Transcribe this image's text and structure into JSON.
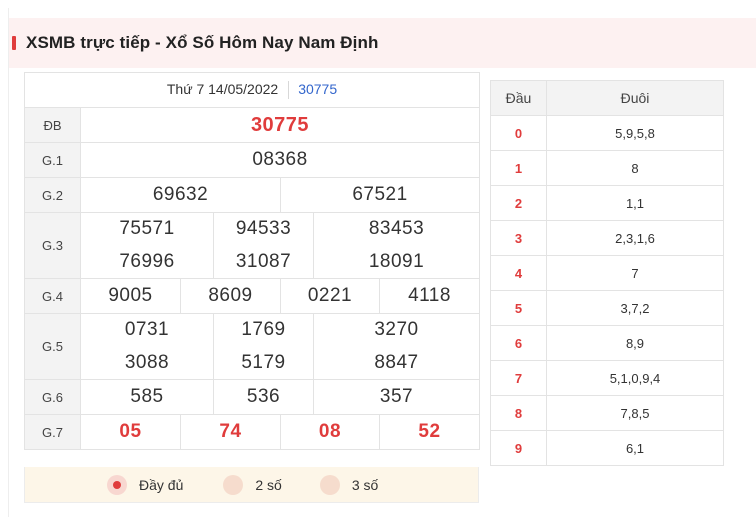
{
  "header": {
    "title": "XSMB trực tiếp - Xổ Số Hôm Nay Nam Định"
  },
  "results": {
    "date": "Thứ 7 14/05/2022",
    "code": "30775",
    "db": {
      "label": "ĐB",
      "value": "30775"
    },
    "g1": {
      "label": "G.1",
      "values": [
        "08368"
      ]
    },
    "g2": {
      "label": "G.2",
      "values": [
        "69632",
        "67521"
      ]
    },
    "g3": {
      "label": "G.3",
      "values": [
        "75571",
        "94533",
        "83453",
        "76996",
        "31087",
        "18091"
      ]
    },
    "g4": {
      "label": "G.4",
      "values": [
        "9005",
        "8609",
        "0221",
        "4118"
      ]
    },
    "g5": {
      "label": "G.5",
      "values": [
        "0731",
        "1769",
        "3270",
        "3088",
        "5179",
        "8847"
      ]
    },
    "g6": {
      "label": "G.6",
      "values": [
        "585",
        "536",
        "357"
      ]
    },
    "g7": {
      "label": "G.7",
      "values": [
        "05",
        "74",
        "08",
        "52"
      ]
    }
  },
  "options": [
    {
      "label": "Đầy đủ",
      "selected": true
    },
    {
      "label": "2 số",
      "selected": false
    },
    {
      "label": "3 số",
      "selected": false
    }
  ],
  "loto": {
    "head_label": "Đầu",
    "tail_label": "Đuôi",
    "rows": [
      {
        "head": "0",
        "tail": "5,9,5,8"
      },
      {
        "head": "1",
        "tail": "8"
      },
      {
        "head": "2",
        "tail": "1,1"
      },
      {
        "head": "3",
        "tail": "2,3,1,6"
      },
      {
        "head": "4",
        "tail": "7"
      },
      {
        "head": "5",
        "tail": "3,7,2"
      },
      {
        "head": "6",
        "tail": "8,9"
      },
      {
        "head": "7",
        "tail": "5,1,0,9,4"
      },
      {
        "head": "8",
        "tail": "7,8,5"
      },
      {
        "head": "9",
        "tail": "6,1"
      }
    ]
  },
  "colors": {
    "accent": "#e03c3c",
    "link": "#3366cc",
    "header_bg": "#fdf1f1",
    "options_bg": "#fdf6e8"
  }
}
